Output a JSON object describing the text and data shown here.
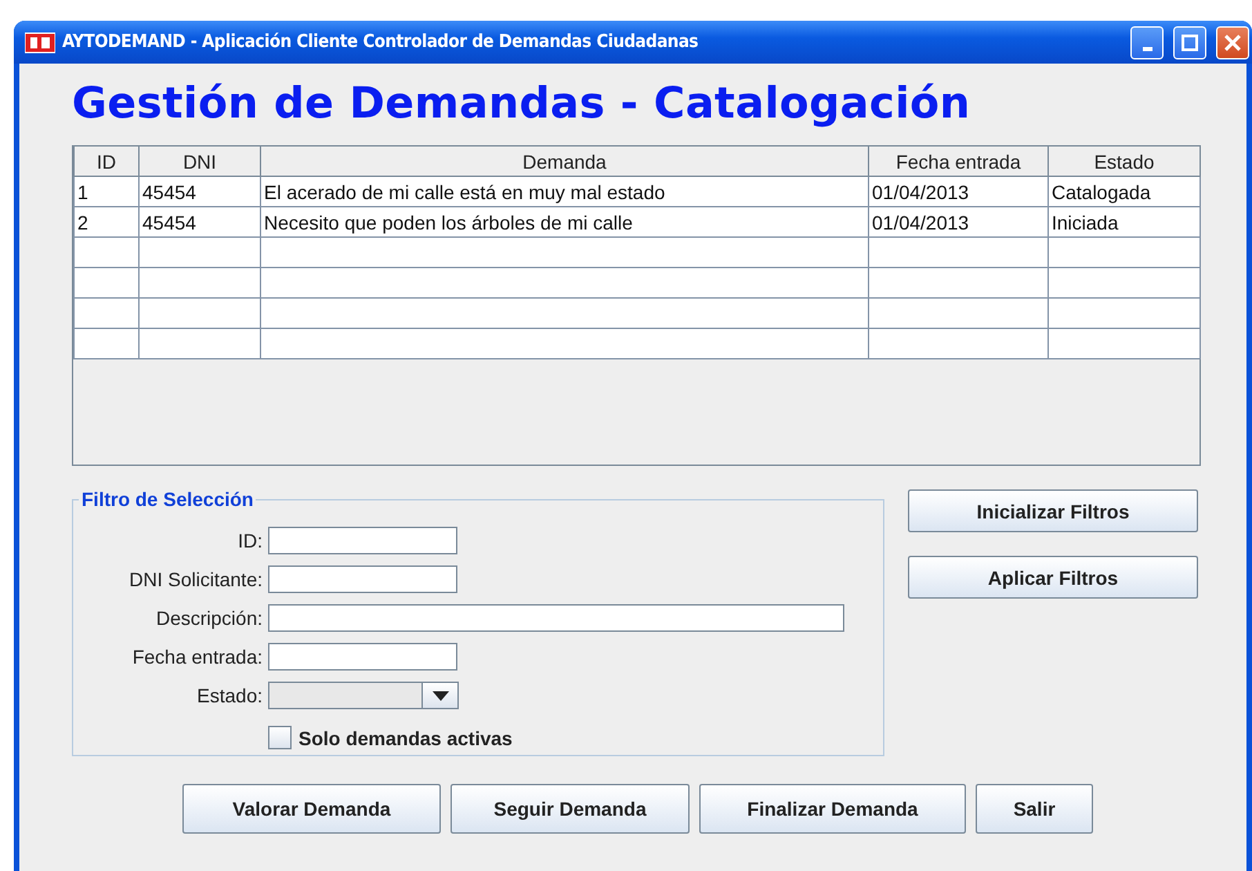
{
  "window": {
    "title": "AYTODEMAND - Aplicación Cliente Controlador de Demandas Ciudadanas"
  },
  "heading": "Gestión de Demandas - Catalogación",
  "table": {
    "columns": [
      "ID",
      "DNI",
      "Demanda",
      "Fecha entrada",
      "Estado"
    ],
    "rows": [
      [
        "1",
        "45454",
        "El acerado de mi calle está en muy mal estado",
        "01/04/2013",
        "Catalogada"
      ],
      [
        "2",
        "45454",
        "Necesito que poden los árboles de mi calle",
        "01/04/2013",
        "Iniciada"
      ]
    ]
  },
  "filter": {
    "legend": "Filtro de Selección",
    "fields": [
      {
        "label": "ID:",
        "kind": "short"
      },
      {
        "label": "DNI Solicitante:",
        "kind": "short"
      },
      {
        "label": "Descripción:",
        "kind": "wide"
      },
      {
        "label": "Fecha entrada:",
        "kind": "short"
      },
      {
        "label": "Estado:",
        "kind": "combo"
      }
    ],
    "checkbox": {
      "label": "Solo demandas activas",
      "checked": false
    }
  },
  "side_buttons": [
    "Inicializar Filtros",
    "Aplicar Filtros"
  ],
  "bottom_buttons": [
    "Valorar Demanda",
    "Seguir Demanda",
    "Finalizar Demanda",
    "Salir"
  ]
}
